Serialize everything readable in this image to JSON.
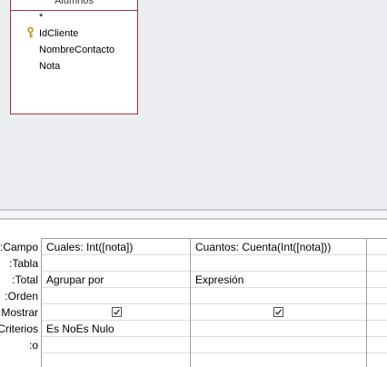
{
  "table": {
    "title": "Alumnos",
    "fields": [
      "*",
      "IdCliente",
      "NombreContacto",
      "Nota"
    ]
  },
  "grid": {
    "row_labels": [
      "Campo:",
      "Tabla:",
      "Total:",
      "Orden:",
      "Mostrar:",
      "Criterios:",
      "o:"
    ],
    "columns": [
      {
        "campo": "Cuales: Int([nota])",
        "tabla": "",
        "total": "Agrupar por",
        "orden": "",
        "mostrar": true,
        "criterios": "Es NoEs Nulo",
        "o": ""
      },
      {
        "campo": "Cuantos: Cuenta(Int([nota]))",
        "tabla": "",
        "total": "Expresión",
        "orden": "",
        "mostrar": true,
        "criterios": "",
        "o": ""
      }
    ]
  }
}
